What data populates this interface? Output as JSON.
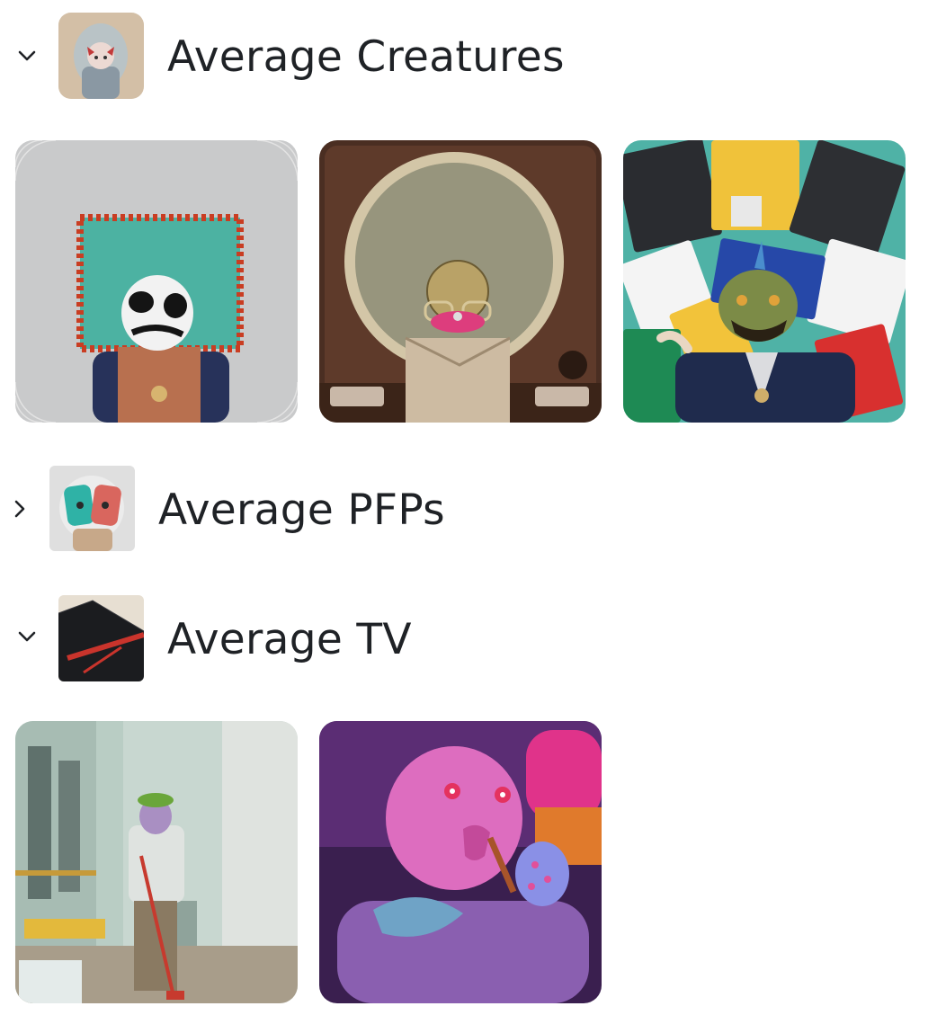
{
  "collections": [
    {
      "title": "Average Creatures",
      "expanded": true,
      "chevron_icon": "chevron-down-icon",
      "items": [
        {
          "name": "creature-ladybug-frame"
        },
        {
          "name": "creature-disco-tv"
        },
        {
          "name": "creature-floppy-disks"
        }
      ]
    },
    {
      "title": "Average PFPs",
      "expanded": false,
      "chevron_icon": "chevron-right-icon",
      "items": []
    },
    {
      "title": "Average TV",
      "expanded": true,
      "chevron_icon": "chevron-down-icon",
      "items": [
        {
          "name": "tv-hallway-janitor"
        },
        {
          "name": "tv-pink-creature"
        }
      ]
    }
  ],
  "colors": {
    "text": "#1f2226",
    "background": "#ffffff"
  }
}
